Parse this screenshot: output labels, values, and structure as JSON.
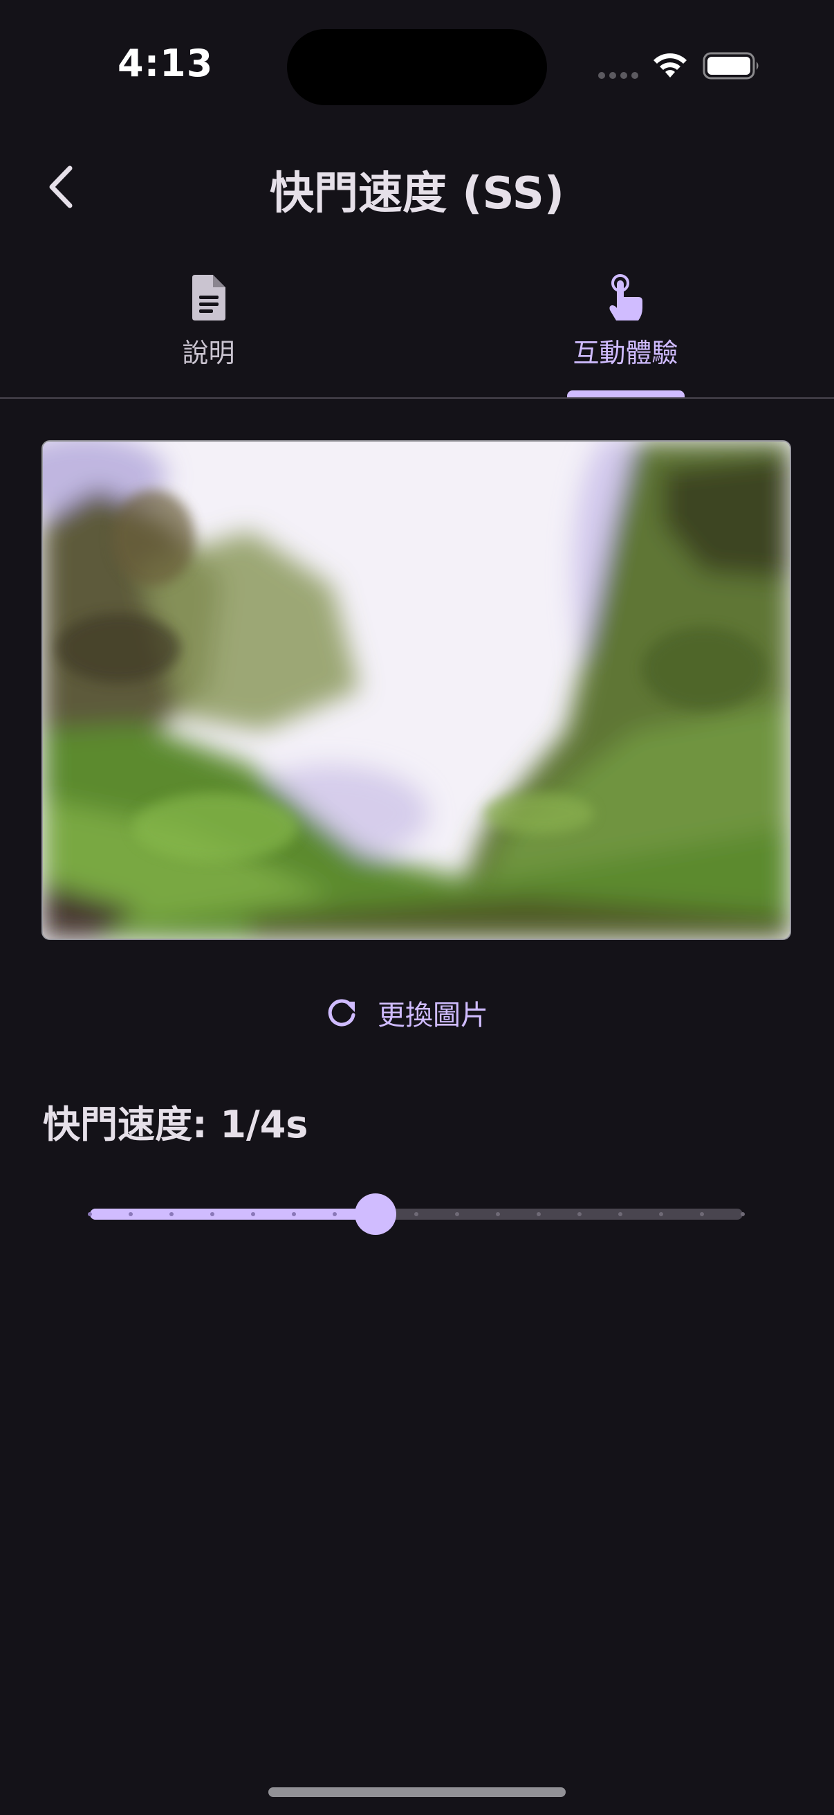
{
  "status_bar": {
    "time": "4:13",
    "icons": [
      "cellular-signal-icon",
      "wifi-icon",
      "battery-icon"
    ]
  },
  "app_bar": {
    "back_icon": "chevron-left-icon",
    "title": "快門速度 (SS)"
  },
  "tabs": [
    {
      "label": "說明",
      "icon": "document-icon",
      "active": false
    },
    {
      "label": "互動體驗",
      "icon": "tap-hand-icon",
      "active": true
    }
  ],
  "preview": {
    "description_icon": "blurred-waterfall-image"
  },
  "change_image": {
    "icon": "refresh-icon",
    "label": "更換圖片"
  },
  "shutter": {
    "label": "快門速度: 1/4s"
  },
  "slider": {
    "value_index": 7,
    "steps": 17
  },
  "colors": {
    "background": "#141218",
    "accent": "#d0bcff",
    "on_surface": "#e6e0e9",
    "on_surface_variant": "#cac4d0",
    "outline": "#49454f"
  }
}
